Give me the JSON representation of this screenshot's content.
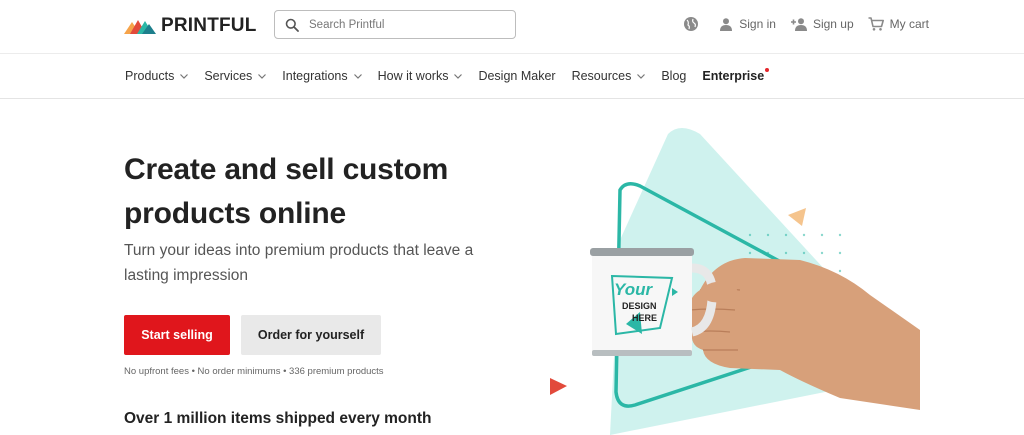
{
  "brand": {
    "name": "PRINTFUL",
    "colors": {
      "accent": "#e0161c",
      "teal": "#2bb7a6",
      "mint": "#c8f0ec"
    }
  },
  "search": {
    "placeholder": "Search Printful"
  },
  "top_actions": {
    "sign_in": "Sign in",
    "sign_up": "Sign up",
    "cart": "My cart"
  },
  "nav": {
    "items": [
      {
        "label": "Products",
        "dropdown": true
      },
      {
        "label": "Services",
        "dropdown": true
      },
      {
        "label": "Integrations",
        "dropdown": true
      },
      {
        "label": "How it works",
        "dropdown": true
      },
      {
        "label": "Design Maker",
        "dropdown": false
      },
      {
        "label": "Resources",
        "dropdown": true
      },
      {
        "label": "Blog",
        "dropdown": false
      },
      {
        "label": "Enterprise",
        "dropdown": false
      }
    ]
  },
  "hero": {
    "title": "Create and sell custom products online",
    "subtitle": "Turn your ideas into premium products that leave a lasting impression",
    "primary_cta": "Start selling",
    "secondary_cta": "Order for yourself",
    "fineprint": "No upfront fees • No order minimums • 336 premium products",
    "stat": "Over 1 million items shipped every month"
  },
  "mug": {
    "line1": "Your",
    "line2": "DESIGN",
    "line3": "HERE"
  },
  "icons": [
    "search-icon",
    "globe-icon",
    "user-icon",
    "add-user-icon",
    "cart-icon",
    "chevron-down-icon"
  ]
}
